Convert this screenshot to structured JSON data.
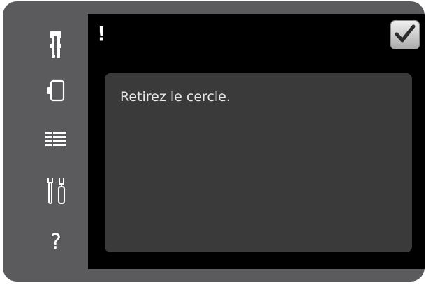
{
  "sidebar": {
    "items": [
      {
        "icon": "presser-foot-icon"
      },
      {
        "icon": "hoop-icon"
      },
      {
        "icon": "menu-list-icon"
      },
      {
        "icon": "tools-icon"
      },
      {
        "icon": "help-icon",
        "glyph": "?"
      }
    ]
  },
  "dialog": {
    "alert_glyph": "!",
    "confirm_icon": "checkmark-icon",
    "message": "Retirez le cercle."
  },
  "colors": {
    "bezel": "#5b5b5d",
    "screen": "#000000",
    "panel": "#3a3a3b",
    "text": "#e6e6e6"
  }
}
